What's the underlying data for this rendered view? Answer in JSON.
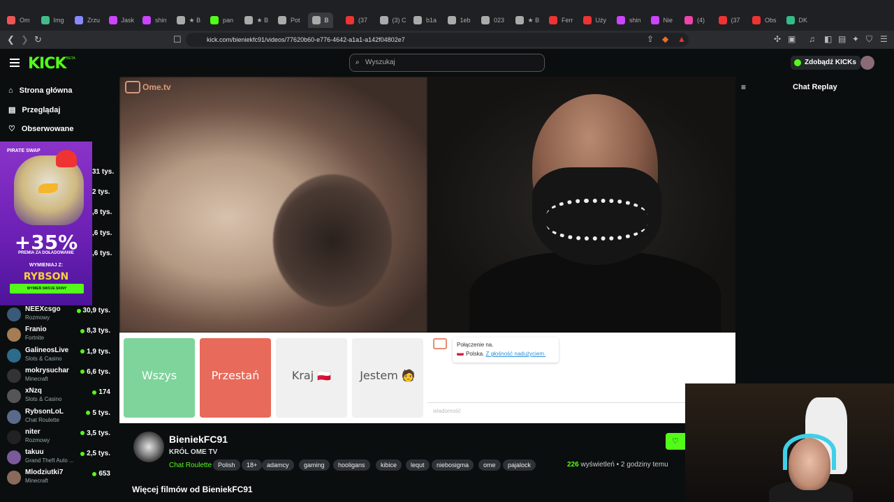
{
  "browser": {
    "tabs": [
      "Om",
      "Img",
      "Zrzu",
      "Jask",
      "shin",
      "★ B",
      "pan",
      "★ B",
      "Pot",
      "B",
      "(37",
      "(3) C",
      "b1a",
      "1eb",
      "023",
      "★ B",
      "Ferr",
      "Uży",
      "shin",
      "Nie",
      "(4)",
      "(37",
      "Obs",
      "DK"
    ],
    "url": "kick.com/bieniekfc91/videos/77620b60-e776-4642-a1a1-a142f04802e7"
  },
  "header": {
    "logo": "KICK",
    "beta": "BETA",
    "search_placeholder": "Wyszukaj",
    "kicks_label": "Zdobądź KICKs"
  },
  "sidebar": {
    "nav": [
      {
        "label": "Strona główna",
        "icon": "home-icon"
      },
      {
        "label": "Przeglądaj",
        "icon": "browse-icon"
      },
      {
        "label": "Obserwowane",
        "icon": "heart-icon"
      }
    ],
    "promo": {
      "brand": "PIRATE SWAP",
      "bonus": "+35%",
      "bonus_text": "PREMIA ZA DOŁADOWANIE",
      "exchange_label": "WYMIENIAJ Z:",
      "code": "RYBSON",
      "button": "WYMIEŃ SWOJE SKINY"
    },
    "partial_counts": [
      "31 tys.",
      "2 tys.",
      ",8 tys.",
      ",6 tys.",
      ",6 tys."
    ],
    "channels": [
      {
        "name": "NEEXcsgo",
        "category": "Rozmowy",
        "viewers": "30,9 tys.",
        "color": "#3a5a7a"
      },
      {
        "name": "Franio",
        "category": "Fortnite",
        "viewers": "8,3 tys.",
        "color": "#a67c52"
      },
      {
        "name": "GalineosLive",
        "category": "Slots & Casino",
        "viewers": "1,9 tys.",
        "color": "#2d6b8a"
      },
      {
        "name": "mokrysuchar",
        "category": "Minecraft",
        "viewers": "6,6 tys.",
        "color": "#333333"
      },
      {
        "name": "xNzq",
        "category": "Slots & Casino",
        "viewers": "174",
        "color": "#555555"
      },
      {
        "name": "RybsonLoL",
        "category": "Chat Roulette",
        "viewers": "5 tys.",
        "color": "#5a6a8a"
      },
      {
        "name": "niter",
        "category": "Rozmowy",
        "viewers": "3,5 tys.",
        "color": "#222222"
      },
      {
        "name": "takuu",
        "category": "Grand Theft Auto ...",
        "viewers": "2,5 tys.",
        "color": "#7a5a9a"
      },
      {
        "name": "Mlodziutki7",
        "category": "Minecraft",
        "viewers": "653",
        "color": "#8a6a5a"
      }
    ]
  },
  "video": {
    "watermark": "Ome.tv",
    "buttons": [
      {
        "label": "Wszys",
        "bg": "#7fd49b",
        "fg": "#ffffff"
      },
      {
        "label": "Przestań",
        "bg": "#e86a5a",
        "fg": "#ffffff"
      },
      {
        "label": "Kraj 🇵🇱",
        "bg": "#f0f0f0",
        "fg": "#555555"
      },
      {
        "label": "Jestem 🧑",
        "bg": "#f0f0f0",
        "fg": "#555555"
      }
    ],
    "message_line1": "Połączenie na.",
    "message_country": "Polska.",
    "message_link": "Z głośność nadużyciem.",
    "message_placeholder": "wiadomość"
  },
  "chat": {
    "title": "Chat Replay"
  },
  "info": {
    "channel": "BieniekFC91",
    "subtitle": "KRÓL OME TV",
    "category": "Chat Roulette",
    "tags": [
      "Polish",
      "18+",
      "adamcy",
      "gaming",
      "hooligans",
      "kibice",
      "lequt",
      "niebosigma",
      "ome",
      "pajalock"
    ],
    "views": "226",
    "views_label": "wyświetleń",
    "time": "2 godziny temu",
    "more_videos": "Więcej filmów od BieniekFC91"
  }
}
